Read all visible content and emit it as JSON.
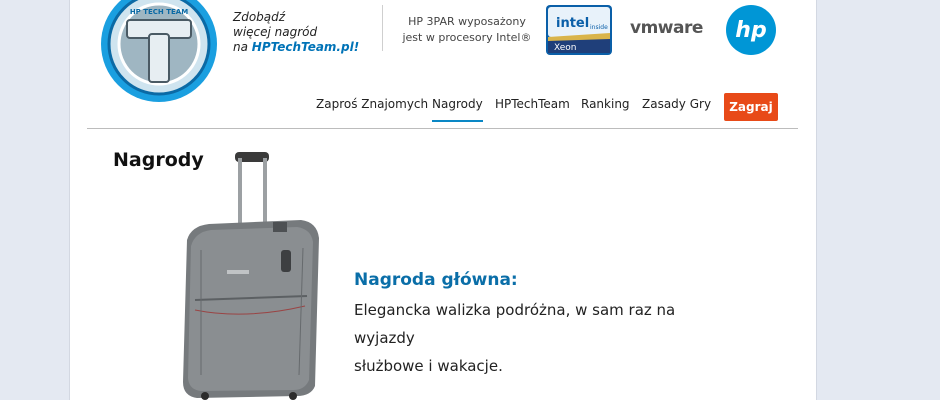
{
  "header": {
    "promo": {
      "line1": "Zdobądź",
      "line2": "więcej nagród",
      "line3_prefix": "na ",
      "line3_link": "HPTechTeam.pl!"
    },
    "logo_text": "HP TECH TEAM",
    "hp3par_line1": "HP 3PAR wyposażony",
    "hp3par_line2": "jest w procesory Intel®",
    "intel": {
      "inside": "intel",
      "inside_small": "inside",
      "product": "Xeon"
    },
    "vmware": "vmware",
    "hp_logo": "hp"
  },
  "nav": {
    "items": [
      {
        "label": "Zaproś Znajomych"
      },
      {
        "label": "Nagrody",
        "active": true
      },
      {
        "label": "HPTechTeam"
      },
      {
        "label": "Ranking"
      },
      {
        "label": "Zasady Gry"
      }
    ],
    "cta": "Zagraj"
  },
  "main": {
    "title": "Nagrody",
    "prize_heading": "Nagroda główna:",
    "prize_description_line1": "Elegancka walizka podróżna, w sam raz na wyjazdy",
    "prize_description_line2": "służbowe i wakacje."
  },
  "colors": {
    "accent_blue": "#0a6ea8",
    "cta_orange": "#e84a18",
    "background": "#e4e9f2"
  },
  "icons": [
    "hp-tech-team-logo-icon",
    "intel-xeon-logo-icon",
    "hp-logo-icon",
    "suitcase-image"
  ]
}
